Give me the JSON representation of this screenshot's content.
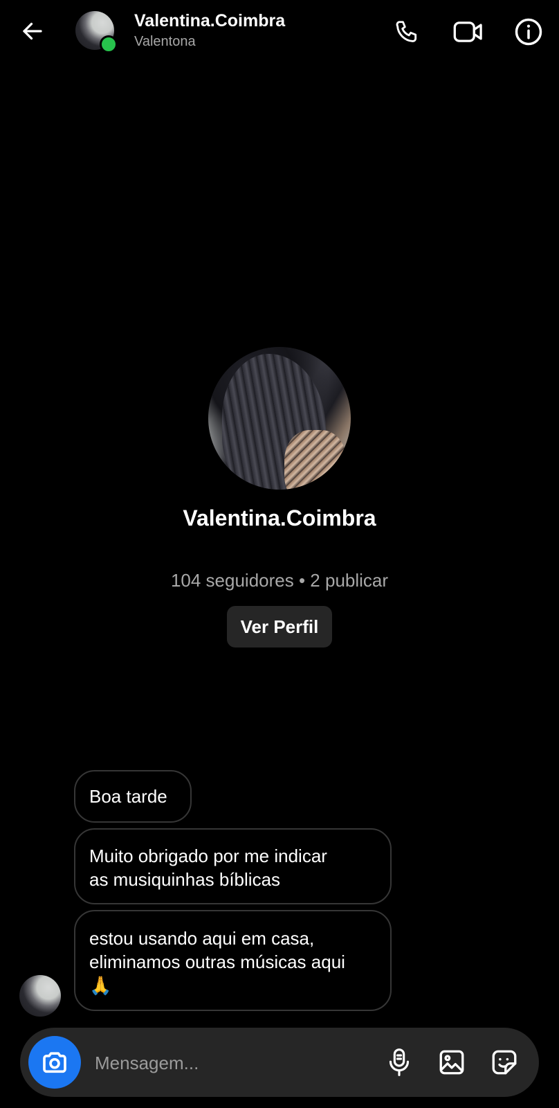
{
  "header": {
    "name": "Valentina.Coimbra",
    "subtitle": "Valentona",
    "icons": {
      "back": "arrow-left-icon",
      "call": "phone-icon",
      "video": "video-camera-icon",
      "info": "info-icon"
    },
    "online_color": "#27c24c"
  },
  "profile": {
    "name": "Valentina.Coimbra",
    "stats": "104 seguidores • 2 publicar",
    "view_button_label": "Ver Perfil"
  },
  "messages": [
    {
      "text": "Boa tarde"
    },
    {
      "text": "Muito obrigado por me indicar\nas musiquinhas bíblicas"
    },
    {
      "text": "estou usando aqui em casa,\neliminamos outras músicas aqui\n🙏"
    }
  ],
  "composer": {
    "placeholder": "Mensagem...",
    "accent": "#1b77f2",
    "icons": {
      "camera": "camera-icon",
      "mic": "microphone-icon",
      "gallery": "image-gallery-icon",
      "sticker": "sticker-icon"
    }
  }
}
